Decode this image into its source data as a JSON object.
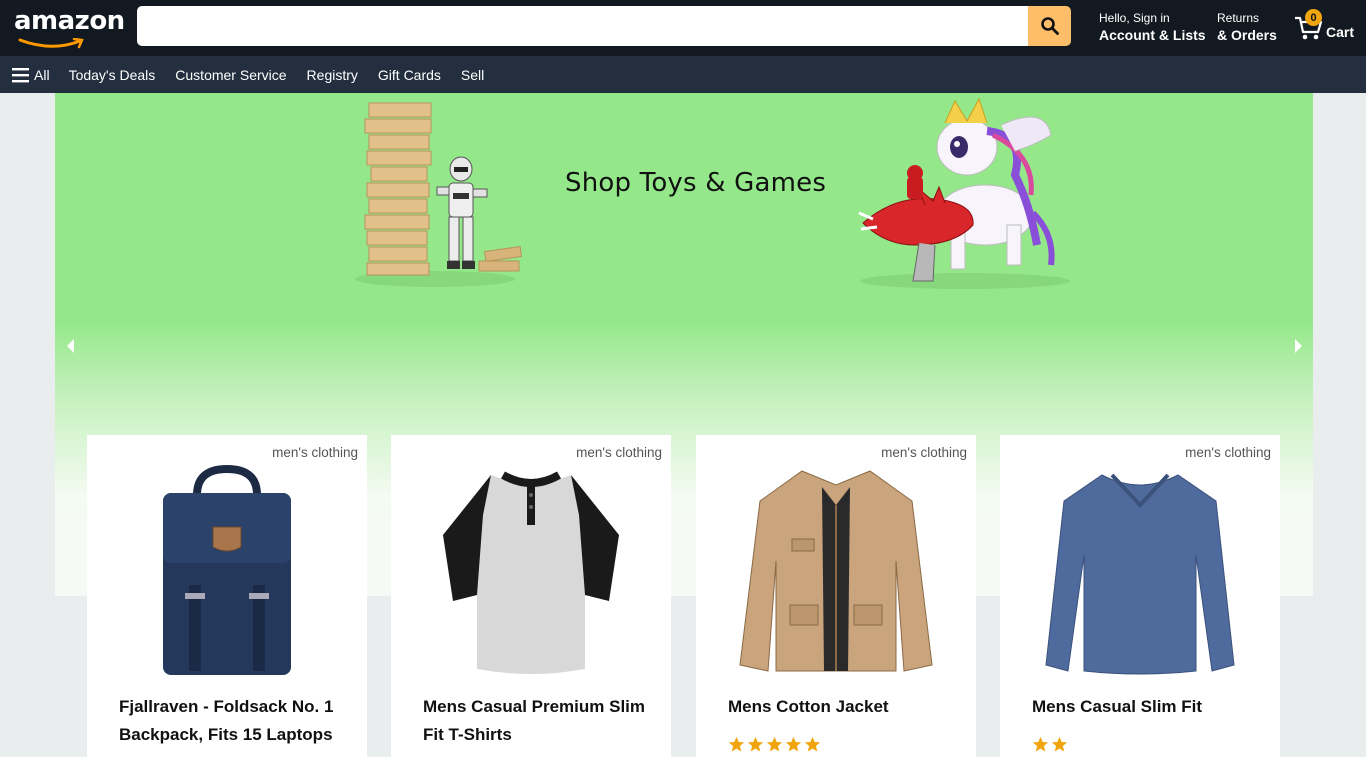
{
  "header": {
    "logo_text": "amazon",
    "search": {
      "value": "",
      "placeholder": ""
    },
    "signin": {
      "line1": "Hello, Sign in",
      "line2": "Account & Lists"
    },
    "returns": {
      "line1": "Returns",
      "line2": "& Orders"
    },
    "cart": {
      "count": "0",
      "label": "Cart"
    }
  },
  "subnav": {
    "all_label": "All",
    "items": [
      "Today's Deals",
      "Customer Service",
      "Registry",
      "Gift Cards",
      "Sell"
    ]
  },
  "hero": {
    "title": "Shop Toys & Games",
    "background": "#94e88a"
  },
  "products": [
    {
      "category": "men's clothing",
      "title": "Fjallraven - Foldsack No. 1 Backpack, Fits 15 Laptops",
      "rating": 0,
      "image": "backpack"
    },
    {
      "category": "men's clothing",
      "title": "Mens Casual Premium Slim Fit T-Shirts",
      "rating": 0,
      "image": "henley-shirt"
    },
    {
      "category": "men's clothing",
      "title": "Mens Cotton Jacket",
      "rating": 5,
      "image": "cotton-jacket"
    },
    {
      "category": "men's clothing",
      "title": "Mens Casual Slim Fit",
      "rating": 2,
      "image": "long-sleeve-tee"
    }
  ],
  "colors": {
    "header_bg": "#131921",
    "subnav_bg": "#232f3e",
    "search_button": "#febd69",
    "star": "#f0a50e",
    "cart_badge": "#f0a50e"
  }
}
